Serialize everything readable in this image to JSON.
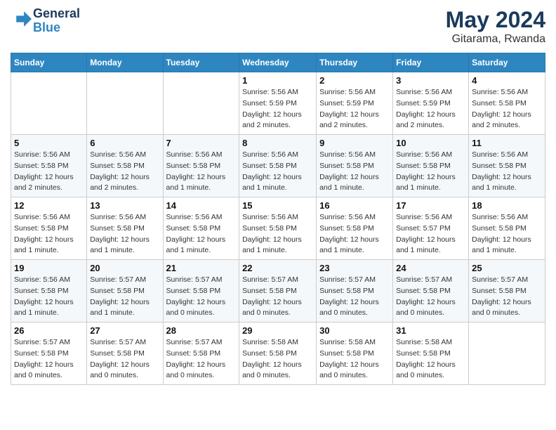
{
  "header": {
    "logo_line1": "General",
    "logo_line2": "Blue",
    "month": "May 2024",
    "location": "Gitarama, Rwanda"
  },
  "days_of_week": [
    "Sunday",
    "Monday",
    "Tuesday",
    "Wednesday",
    "Thursday",
    "Friday",
    "Saturday"
  ],
  "weeks": [
    [
      {
        "day": "",
        "info": ""
      },
      {
        "day": "",
        "info": ""
      },
      {
        "day": "",
        "info": ""
      },
      {
        "day": "1",
        "info": "Sunrise: 5:56 AM\nSunset: 5:59 PM\nDaylight: 12 hours\nand 2 minutes."
      },
      {
        "day": "2",
        "info": "Sunrise: 5:56 AM\nSunset: 5:59 PM\nDaylight: 12 hours\nand 2 minutes."
      },
      {
        "day": "3",
        "info": "Sunrise: 5:56 AM\nSunset: 5:59 PM\nDaylight: 12 hours\nand 2 minutes."
      },
      {
        "day": "4",
        "info": "Sunrise: 5:56 AM\nSunset: 5:58 PM\nDaylight: 12 hours\nand 2 minutes."
      }
    ],
    [
      {
        "day": "5",
        "info": "Sunrise: 5:56 AM\nSunset: 5:58 PM\nDaylight: 12 hours\nand 2 minutes."
      },
      {
        "day": "6",
        "info": "Sunrise: 5:56 AM\nSunset: 5:58 PM\nDaylight: 12 hours\nand 2 minutes."
      },
      {
        "day": "7",
        "info": "Sunrise: 5:56 AM\nSunset: 5:58 PM\nDaylight: 12 hours\nand 1 minute."
      },
      {
        "day": "8",
        "info": "Sunrise: 5:56 AM\nSunset: 5:58 PM\nDaylight: 12 hours\nand 1 minute."
      },
      {
        "day": "9",
        "info": "Sunrise: 5:56 AM\nSunset: 5:58 PM\nDaylight: 12 hours\nand 1 minute."
      },
      {
        "day": "10",
        "info": "Sunrise: 5:56 AM\nSunset: 5:58 PM\nDaylight: 12 hours\nand 1 minute."
      },
      {
        "day": "11",
        "info": "Sunrise: 5:56 AM\nSunset: 5:58 PM\nDaylight: 12 hours\nand 1 minute."
      }
    ],
    [
      {
        "day": "12",
        "info": "Sunrise: 5:56 AM\nSunset: 5:58 PM\nDaylight: 12 hours\nand 1 minute."
      },
      {
        "day": "13",
        "info": "Sunrise: 5:56 AM\nSunset: 5:58 PM\nDaylight: 12 hours\nand 1 minute."
      },
      {
        "day": "14",
        "info": "Sunrise: 5:56 AM\nSunset: 5:58 PM\nDaylight: 12 hours\nand 1 minute."
      },
      {
        "day": "15",
        "info": "Sunrise: 5:56 AM\nSunset: 5:58 PM\nDaylight: 12 hours\nand 1 minute."
      },
      {
        "day": "16",
        "info": "Sunrise: 5:56 AM\nSunset: 5:58 PM\nDaylight: 12 hours\nand 1 minute."
      },
      {
        "day": "17",
        "info": "Sunrise: 5:56 AM\nSunset: 5:57 PM\nDaylight: 12 hours\nand 1 minute."
      },
      {
        "day": "18",
        "info": "Sunrise: 5:56 AM\nSunset: 5:58 PM\nDaylight: 12 hours\nand 1 minute."
      }
    ],
    [
      {
        "day": "19",
        "info": "Sunrise: 5:56 AM\nSunset: 5:58 PM\nDaylight: 12 hours\nand 1 minute."
      },
      {
        "day": "20",
        "info": "Sunrise: 5:57 AM\nSunset: 5:58 PM\nDaylight: 12 hours\nand 1 minute."
      },
      {
        "day": "21",
        "info": "Sunrise: 5:57 AM\nSunset: 5:58 PM\nDaylight: 12 hours\nand 0 minutes."
      },
      {
        "day": "22",
        "info": "Sunrise: 5:57 AM\nSunset: 5:58 PM\nDaylight: 12 hours\nand 0 minutes."
      },
      {
        "day": "23",
        "info": "Sunrise: 5:57 AM\nSunset: 5:58 PM\nDaylight: 12 hours\nand 0 minutes."
      },
      {
        "day": "24",
        "info": "Sunrise: 5:57 AM\nSunset: 5:58 PM\nDaylight: 12 hours\nand 0 minutes."
      },
      {
        "day": "25",
        "info": "Sunrise: 5:57 AM\nSunset: 5:58 PM\nDaylight: 12 hours\nand 0 minutes."
      }
    ],
    [
      {
        "day": "26",
        "info": "Sunrise: 5:57 AM\nSunset: 5:58 PM\nDaylight: 12 hours\nand 0 minutes."
      },
      {
        "day": "27",
        "info": "Sunrise: 5:57 AM\nSunset: 5:58 PM\nDaylight: 12 hours\nand 0 minutes."
      },
      {
        "day": "28",
        "info": "Sunrise: 5:57 AM\nSunset: 5:58 PM\nDaylight: 12 hours\nand 0 minutes."
      },
      {
        "day": "29",
        "info": "Sunrise: 5:58 AM\nSunset: 5:58 PM\nDaylight: 12 hours\nand 0 minutes."
      },
      {
        "day": "30",
        "info": "Sunrise: 5:58 AM\nSunset: 5:58 PM\nDaylight: 12 hours\nand 0 minutes."
      },
      {
        "day": "31",
        "info": "Sunrise: 5:58 AM\nSunset: 5:58 PM\nDaylight: 12 hours\nand 0 minutes."
      },
      {
        "day": "",
        "info": ""
      }
    ]
  ]
}
